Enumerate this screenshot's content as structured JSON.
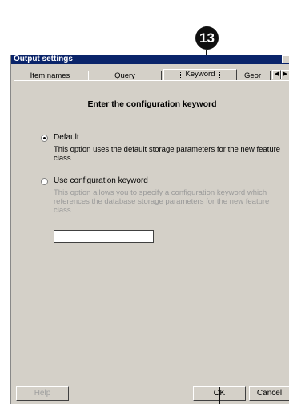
{
  "callout": {
    "number": "13"
  },
  "dialog": {
    "title": "Output settings",
    "tabs": [
      {
        "label": "Item names"
      },
      {
        "label": "Query"
      },
      {
        "label": "Keyword",
        "active": true
      },
      {
        "label": "Geor"
      }
    ],
    "heading": "Enter the configuration keyword",
    "options": [
      {
        "label": "Default",
        "selected": true,
        "description": "This option uses the default storage parameters for the new feature class."
      },
      {
        "label": "Use configuration keyword",
        "selected": false,
        "description": "This option allows you to specify a configuration keyword which references the database storage parameters for the new feature class."
      }
    ],
    "keyword_value": "",
    "buttons": {
      "help": "Help",
      "ok": "OK",
      "cancel": "Cancel"
    }
  }
}
